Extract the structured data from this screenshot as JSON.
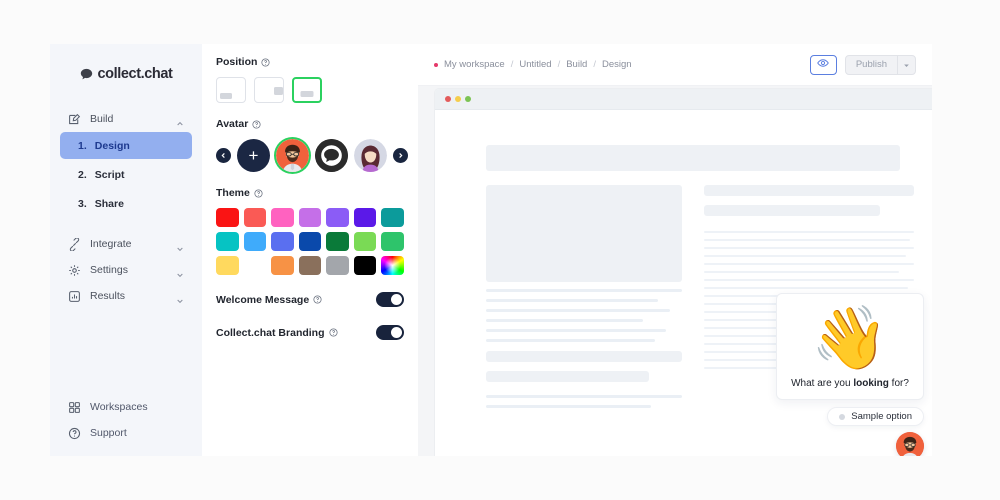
{
  "brand": {
    "name": "collect.chat",
    "logo_icon": "chat-bubble-icon"
  },
  "sidebar": {
    "groups": [
      {
        "label": "Build",
        "icon": "edit-square-icon",
        "caret": "chevron-up-icon",
        "expanded": true
      },
      {
        "label": "Integrate",
        "icon": "plug-icon",
        "caret": "chevron-down-icon",
        "expanded": false
      },
      {
        "label": "Settings",
        "icon": "gear-icon",
        "caret": "chevron-down-icon",
        "expanded": false
      },
      {
        "label": "Results",
        "icon": "chart-icon",
        "caret": "chevron-down-icon",
        "expanded": false
      }
    ],
    "steps": [
      {
        "num": "1.",
        "label": "Design",
        "active": true
      },
      {
        "num": "2.",
        "label": "Script",
        "active": false
      },
      {
        "num": "3.",
        "label": "Share",
        "active": false
      }
    ],
    "bottom": [
      {
        "label": "Workspaces",
        "icon": "grid-icon"
      },
      {
        "label": "Support",
        "icon": "help-circle-icon"
      }
    ],
    "active_color": "#93afef",
    "active_text_color": "#1e3a8f"
  },
  "topbar": {
    "breadcrumb": [
      "My workspace",
      "Untitled",
      "Build",
      "Design"
    ],
    "separator": "/",
    "dot_color": "#e5396a",
    "preview_icon": "eye-icon",
    "publish_label": "Publish",
    "publish_caret_icon": "chevron-down-icon",
    "accent_color": "#5b7fe0"
  },
  "settings": {
    "position": {
      "title": "Position",
      "help_icon": "help-circle-icon",
      "options": [
        {
          "name": "bottom-left",
          "selected": false
        },
        {
          "name": "right-side",
          "selected": false
        },
        {
          "name": "bottom-center",
          "selected": true
        }
      ],
      "selected_color": "#2bd15f"
    },
    "avatar": {
      "title": "Avatar",
      "help_icon": "help-circle-icon",
      "prev_icon": "chevron-left-icon",
      "next_icon": "chevron-right-icon",
      "add_label": "+",
      "items": [
        {
          "name": "add-avatar",
          "type": "add",
          "selected": false
        },
        {
          "name": "bearded-man-avatar",
          "type": "person",
          "selected": true
        },
        {
          "name": "chat-bubble-avatar",
          "type": "bubble",
          "selected": false
        },
        {
          "name": "woman-avatar",
          "type": "person",
          "selected": false
        }
      ]
    },
    "theme": {
      "title": "Theme",
      "help_icon": "help-circle-icon",
      "colors": [
        "#fa1414",
        "#fa5a55",
        "#ff62c0",
        "#c56fe8",
        "#8b5cf6",
        "#5b19e8",
        "#0c9b9b",
        "#06c3c3",
        "#3fabfb",
        "#5a6ff0",
        "#0a49ab",
        "#0a7a39",
        "#7ada55",
        "#2ec46b",
        "#ffd95e",
        "#fcb košice",
        "#f79245",
        "#8a705c",
        "#a3a6ab",
        "#000000",
        "rainbow"
      ]
    },
    "toggles": [
      {
        "label": "Welcome Message",
        "help_icon": "help-circle-icon",
        "on": true
      },
      {
        "label": "Collect.chat Branding",
        "help_icon": "help-circle-icon",
        "on": true
      }
    ],
    "toggle_on_color": "#18233c"
  },
  "preview": {
    "window_dots": [
      "#e35b5b",
      "#f5cd4c",
      "#7cc353"
    ],
    "chat": {
      "emoji": "👋",
      "emoji_name": "waving-hand-emoji",
      "question_prefix": "What are you ",
      "question_bold": "looking",
      "question_suffix": " for?",
      "option_label": "Sample option",
      "avatar_name": "bearded-man-avatar"
    }
  }
}
